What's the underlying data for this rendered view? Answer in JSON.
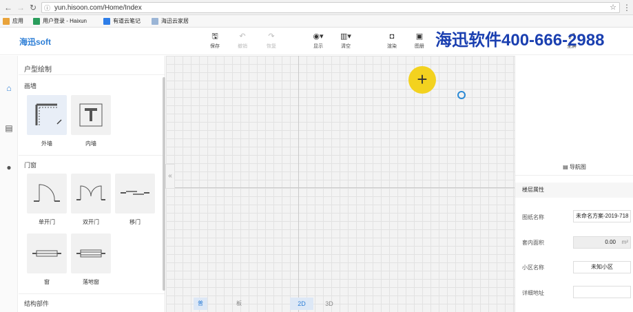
{
  "browser": {
    "url": "yun.hisoon.com/Home/Index",
    "bookmarks": [
      {
        "label": "应用",
        "color": "#e9a33a"
      },
      {
        "label": "用户登录 - Haixun",
        "color": "#2a9d5c"
      },
      {
        "label": "有道云笔记",
        "color": "#2f7ee8"
      },
      {
        "label": "海迅云家居",
        "color": "#9bb5d6"
      }
    ]
  },
  "app": {
    "logo": "海迅soft",
    "watermark": "海迅软件400-666-2988",
    "toolbar": [
      {
        "icon": "save-icon",
        "label": "保存",
        "enabled": true
      },
      {
        "icon": "undo-icon",
        "label": "撤销",
        "enabled": false
      },
      {
        "icon": "redo-icon",
        "label": "恢复",
        "enabled": false
      },
      {
        "icon": "eye-icon",
        "label": "显示",
        "enabled": true
      },
      {
        "icon": "clear-icon",
        "label": "清空",
        "enabled": true
      },
      {
        "icon": "camera-icon",
        "label": "渲染",
        "enabled": true
      },
      {
        "icon": "album-icon",
        "label": "图册",
        "enabled": true
      },
      {
        "icon": "fullscreen-icon",
        "label": "全屏",
        "enabled": true
      }
    ]
  },
  "sidebar": {
    "icons": [
      "home-icon",
      "box-icon",
      "user-icon"
    ]
  },
  "panel": {
    "title": "户型绘制",
    "sections": [
      {
        "title": "画墙",
        "items": [
          "外墙",
          "内墙"
        ]
      },
      {
        "title": "门窗",
        "items": [
          "单开门",
          "双开门",
          "移门",
          "窗",
          "落地窗"
        ]
      },
      {
        "title": "结构部件",
        "items": []
      }
    ]
  },
  "canvas": {
    "modes": [
      "普通模式",
      "板件模式"
    ],
    "views": [
      "2D",
      "3D"
    ],
    "active_mode": "普通模式",
    "active_view": "2D"
  },
  "right_panel": {
    "nav_label": "导航图",
    "floor_title": "楼层属性",
    "props": [
      {
        "label": "图纸名称",
        "value": "未命名方案-2019-718"
      },
      {
        "label": "套内面积",
        "value": "0.00",
        "unit": "m²"
      },
      {
        "label": "小区名称",
        "value": "未知小区"
      },
      {
        "label": "详细地址",
        "value": ""
      }
    ]
  }
}
